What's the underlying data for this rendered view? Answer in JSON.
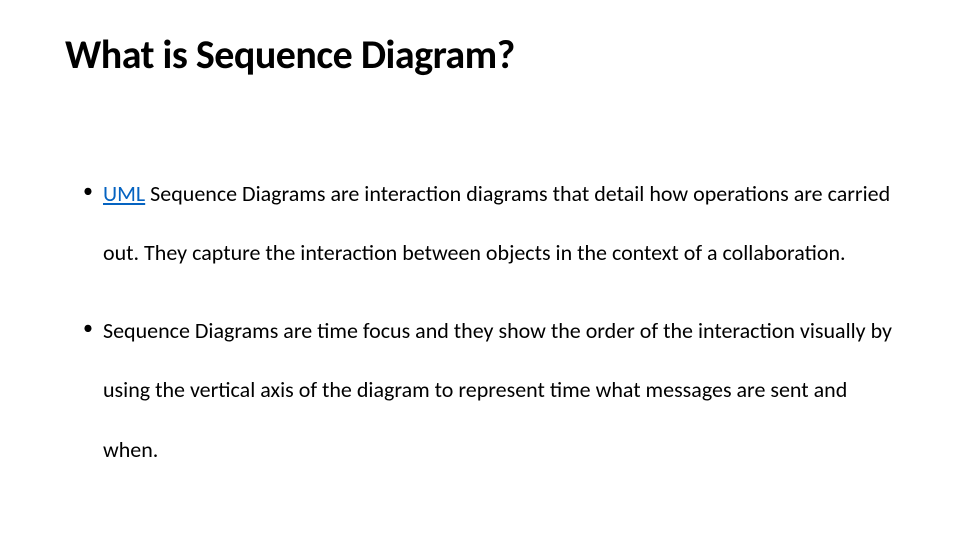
{
  "title": "What is Sequence Diagram?",
  "bullets": {
    "item1": {
      "link_text": "UML",
      "rest": " Sequence Diagrams are interaction diagrams that detail how operations are carried out. They capture the interaction between objects in the context of a collaboration."
    },
    "item2": {
      "text": " Sequence Diagrams are time focus and they show the order of the interaction visually by using the vertical axis of the diagram to represent time what messages are sent and when."
    }
  }
}
